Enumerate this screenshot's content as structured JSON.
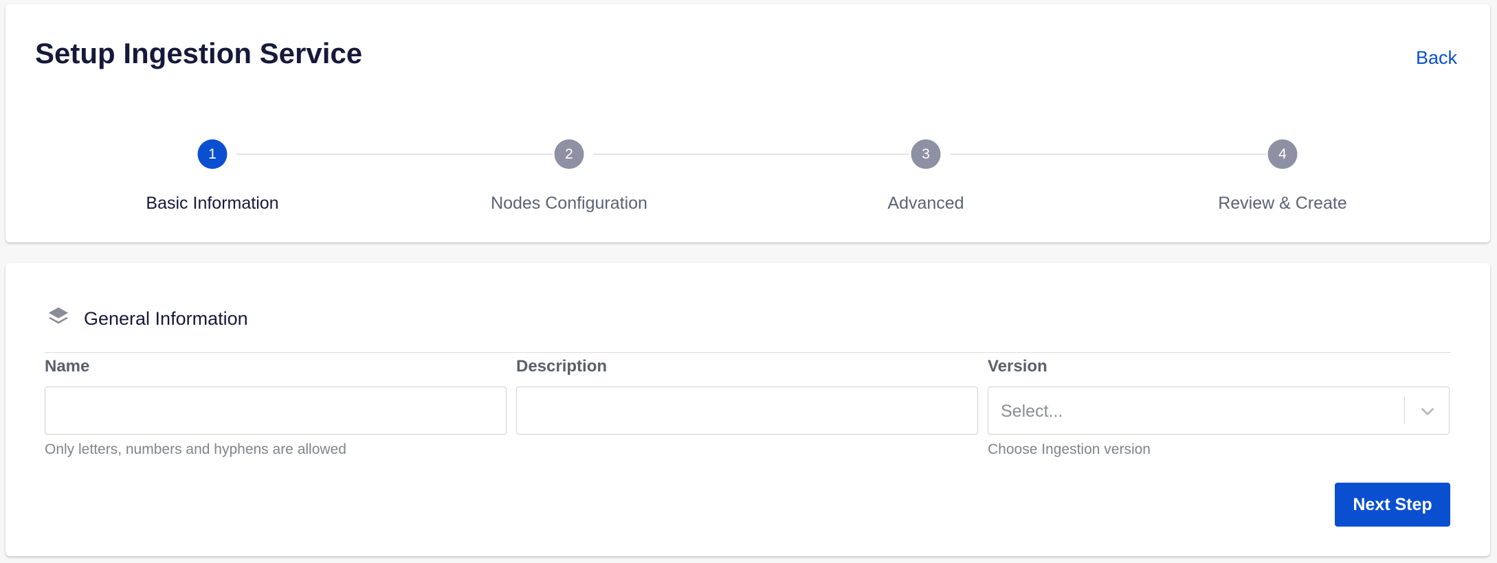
{
  "header": {
    "title": "Setup Ingestion Service",
    "back_label": "Back"
  },
  "stepper": {
    "steps": [
      {
        "number": "1",
        "label": "Basic Information",
        "active": true
      },
      {
        "number": "2",
        "label": "Nodes Configuration",
        "active": false
      },
      {
        "number": "3",
        "label": "Advanced",
        "active": false
      },
      {
        "number": "4",
        "label": "Review & Create",
        "active": false
      }
    ]
  },
  "form": {
    "section_icon": "layers-icon",
    "section_title": "General Information",
    "name": {
      "label": "Name",
      "value": "",
      "helper": "Only letters, numbers and hyphens are allowed"
    },
    "description": {
      "label": "Description",
      "value": ""
    },
    "version": {
      "label": "Version",
      "placeholder": "Select...",
      "helper": "Choose Ingestion version"
    },
    "next_label": "Next Step"
  },
  "colors": {
    "accent": "#0b4fd1",
    "inactive_step": "#8e90a3",
    "title": "#16193a"
  }
}
